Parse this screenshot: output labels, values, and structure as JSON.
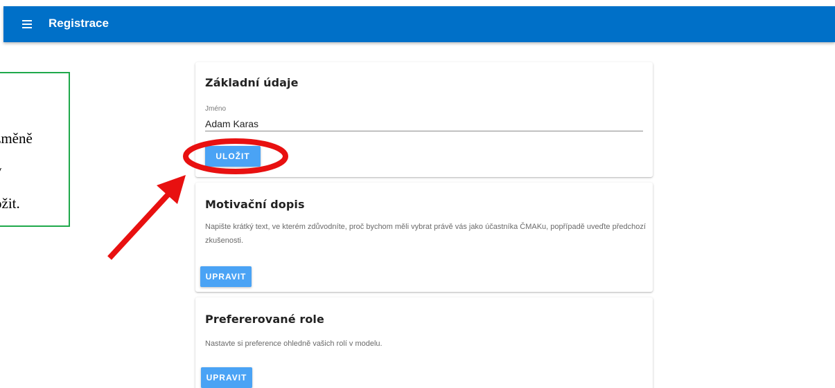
{
  "app_bar": {
    "title": "Registrace",
    "menu_icon": "hamburger-menu-icon",
    "color": "#0070c8"
  },
  "note": {
    "lines": [
      "změně",
      "y",
      "ožit."
    ],
    "border_color": "#1ea84a"
  },
  "basic_info": {
    "title": "Základní údaje",
    "name_label": "Jméno",
    "name_value": "Adam Karas",
    "save_label": "ULOŽIT"
  },
  "motivation": {
    "title": "Motivační dopis",
    "description": "Napište krátký text, ve kterém zdůvodníte, proč bychom měli vybrat právě vás jako účastníka ČMAKu, popřípadě uveďte předchozí zkušenosti.",
    "edit_label": "UPRAVIT"
  },
  "roles": {
    "title": "Prefererované role",
    "description": "Nastavte si preference ohledně vašich rolí v modelu.",
    "edit_label": "UPRAVIT"
  },
  "annotation": {
    "highlight_color": "#e81010",
    "arrow_color": "#e81010"
  },
  "button_color": "#4aa3f5"
}
